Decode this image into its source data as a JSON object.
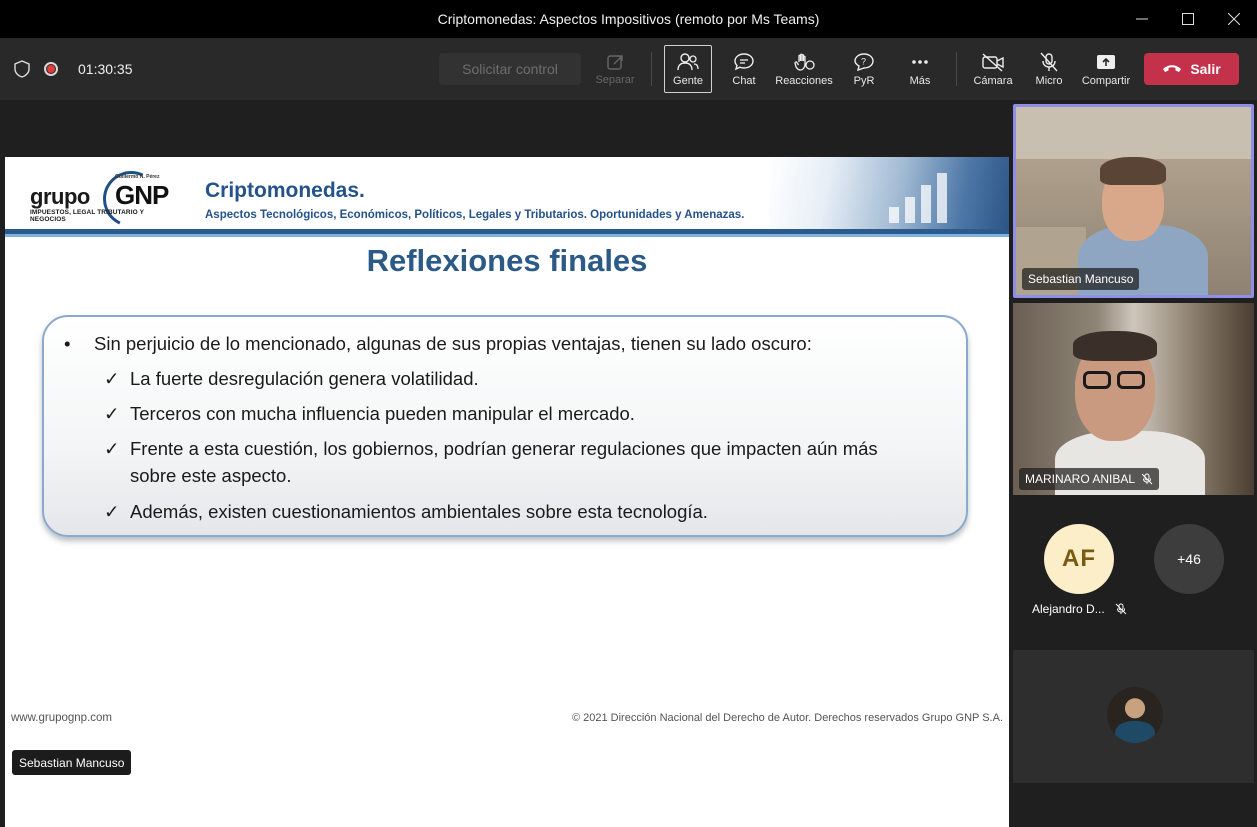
{
  "window": {
    "title": "Criptomonedas: Aspectos Impositivos (remoto por Ms Teams)"
  },
  "toolbar": {
    "timer": "01:30:35",
    "request_control": "Solicitar control",
    "buttons": {
      "separar": "Separar",
      "gente": "Gente",
      "chat": "Chat",
      "reacciones": "Reacciones",
      "pyr": "PyR",
      "mas": "Más",
      "camara": "Cámara",
      "micro": "Micro",
      "compartir": "Compartir"
    },
    "leave": "Salir",
    "leave_color": "#c4314b"
  },
  "slide": {
    "logo": {
      "grupo": "grupo",
      "gnp": "GNP",
      "small": "Guillermo N. Pérez",
      "sub": "IMPUESTOS, LEGAL TRIBUTARIO Y NEGOCIOS"
    },
    "title": "Criptomonedas.",
    "subtitle": "Aspectos Tecnológicos, Económicos, Políticos, Legales y Tributarios. Oportunidades y Amenazas.",
    "heading": "Reflexiones finales",
    "bullet": "Sin perjuicio de lo mencionado, algunas de sus propias ventajas, tienen su lado oscuro:",
    "bullet_mark": "•",
    "check_mark": "✓",
    "checks": [
      "La fuerte desregulación genera volatilidad.",
      "Terceros con mucha influencia pueden manipular el mercado.",
      "Frente a esta cuestión, los gobiernos, podrían generar regulaciones que impacten aún más sobre este aspecto.",
      "Además, existen cuestionamientos ambientales sobre esta tecnología."
    ],
    "footer_left": "www.grupognp.com",
    "footer_right": "© 2021 Dirección Nacional del Derecho de Autor. Derechos reservados Grupo GNP S.A."
  },
  "presenter_label": "Sebastian Mancuso",
  "participants": {
    "tile1_name": "Sebastian Mancuso",
    "tile2_name": "MARINARO ANIBAL",
    "avatar_initials": "AF",
    "avatar_name": "Alejandro D...",
    "more_count": "+46"
  }
}
